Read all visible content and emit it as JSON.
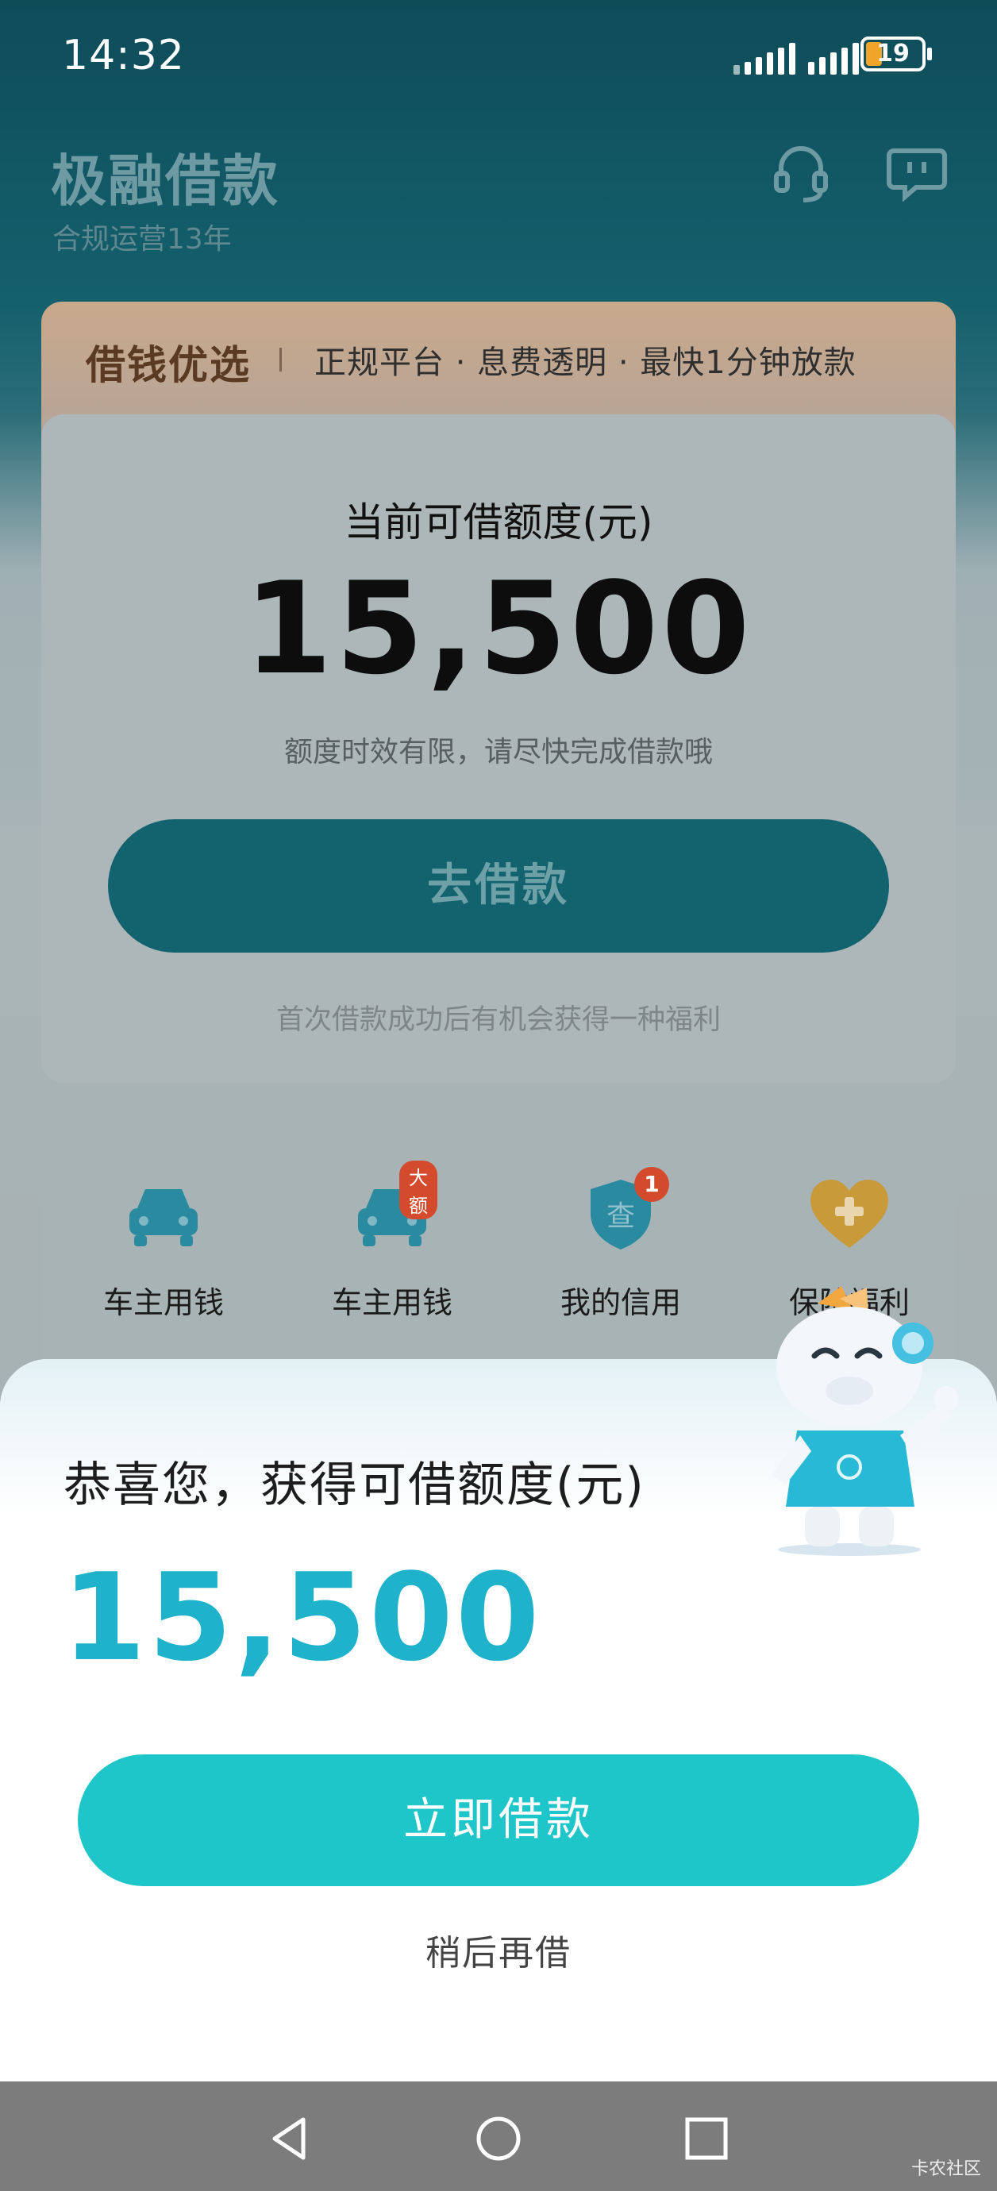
{
  "status": {
    "time": "14:32",
    "battery": "19"
  },
  "header": {
    "title": "极融借款",
    "subtitle": "合规运营13年"
  },
  "promo": {
    "title": "借钱优选",
    "text": "正规平台 · 息费透明 · 最快1分钟放款"
  },
  "card": {
    "label": "当前可借额度(元)",
    "amount": "15,500",
    "tip": "额度时效有限，请尽快完成借款哦",
    "button": "去借款",
    "note": "首次借款成功后有机会获得一种福利"
  },
  "grid": {
    "items": [
      {
        "label": "车主用钱",
        "icon": "car-icon"
      },
      {
        "label": "车主用钱",
        "icon": "car-icon",
        "badge": "大额"
      },
      {
        "label": "我的信用",
        "icon": "credit-shield-icon",
        "glyph": "查",
        "badge": "1"
      },
      {
        "label": "保险福利",
        "icon": "heart-plus-icon"
      }
    ]
  },
  "sheet": {
    "title": "恭喜您，获得可借额度(元)",
    "amount": "15,500",
    "button": "立即借款",
    "later": "稍后再借"
  },
  "watermark": "卡农社区",
  "colors": {
    "primary": "#1ec6ca",
    "amount": "#1fb2cb",
    "dark_teal": "#13636f"
  }
}
